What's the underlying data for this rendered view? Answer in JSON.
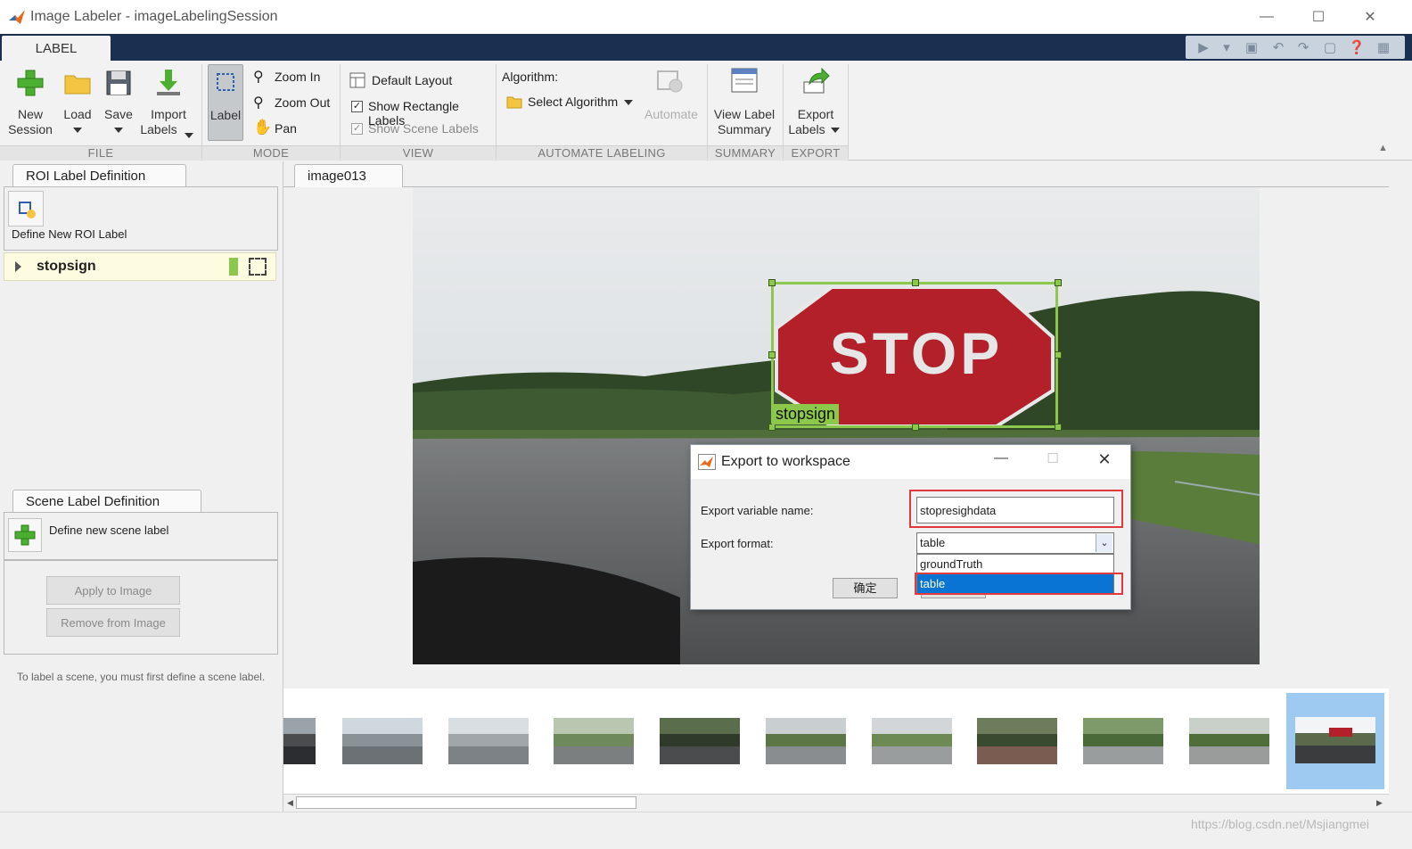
{
  "window": {
    "title": "Image Labeler - imageLabelingSession"
  },
  "ribbon": {
    "tab": "LABEL",
    "file": {
      "section": "FILE",
      "new_session": [
        "New",
        "Session"
      ],
      "load": "Load",
      "save": "Save",
      "import_labels": [
        "Import",
        "Labels"
      ]
    },
    "mode": {
      "section": "MODE",
      "label": "Label",
      "zoom_in": "Zoom In",
      "zoom_out": "Zoom Out",
      "pan": "Pan"
    },
    "view": {
      "section": "VIEW",
      "default_layout": "Default Layout",
      "show_rectangle_labels": "Show Rectangle Labels",
      "show_scene_labels": "Show Scene Labels",
      "show_rectangle_labels_checked": true,
      "show_scene_labels_checked": true
    },
    "automate": {
      "section": "AUTOMATE LABELING",
      "algorithm_label": "Algorithm:",
      "select_algorithm": "Select Algorithm",
      "automate": "Automate"
    },
    "summary": {
      "section": "SUMMARY",
      "view_label_summary": [
        "View Label",
        "Summary"
      ]
    },
    "export": {
      "section": "EXPORT",
      "export_labels": [
        "Export",
        "Labels"
      ]
    }
  },
  "roi_panel": {
    "tab": "ROI Label Definition",
    "define_new": "Define New ROI Label",
    "labels": [
      {
        "name": "stopsign",
        "color": "#8cc84b"
      }
    ]
  },
  "scene_panel": {
    "tab": "Scene Label Definition",
    "define_new": "Define new scene label",
    "apply_button": "Apply to Image",
    "remove_button": "Remove from Image",
    "hint": "To label a scene, you must first define a scene label."
  },
  "image_tab": "image013",
  "roi_box_label": "stopsign",
  "stop_sign_text": "STOP",
  "dialog": {
    "title": "Export to workspace",
    "var_label": "Export variable name:",
    "var_value": "stopresighdata",
    "format_label": "Export format:",
    "format_value": "table",
    "options": [
      "groundTruth",
      "table"
    ],
    "selected_option": "table",
    "ok_button": "确定"
  },
  "watermark": "https://blog.csdn.net/Msjiangmei",
  "colors": {
    "ribbon_dark": "#1b2f50",
    "roi_green": "#8cc84b",
    "highlight": "#e0393e",
    "selection": "#0a74d5"
  }
}
